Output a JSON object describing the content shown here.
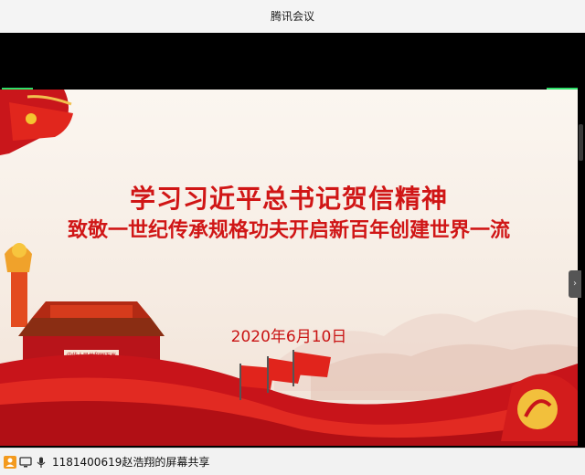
{
  "app": {
    "title": "腾讯会议"
  },
  "slide": {
    "title": "学习习近平总书记贺信精神",
    "subtitle": "致敬一世纪传承规格功夫开启新百年创建世界一流",
    "date": "2020年6月10日",
    "gate_sign": "中华人民共和国万岁",
    "colors": {
      "red": "#d01616",
      "bg": "#f7ede4"
    }
  },
  "status": {
    "sharer_text": "1181400619赵浩翔的屏幕共享",
    "icons": [
      "avatar-icon",
      "screen-share-icon",
      "microphone-icon"
    ]
  }
}
